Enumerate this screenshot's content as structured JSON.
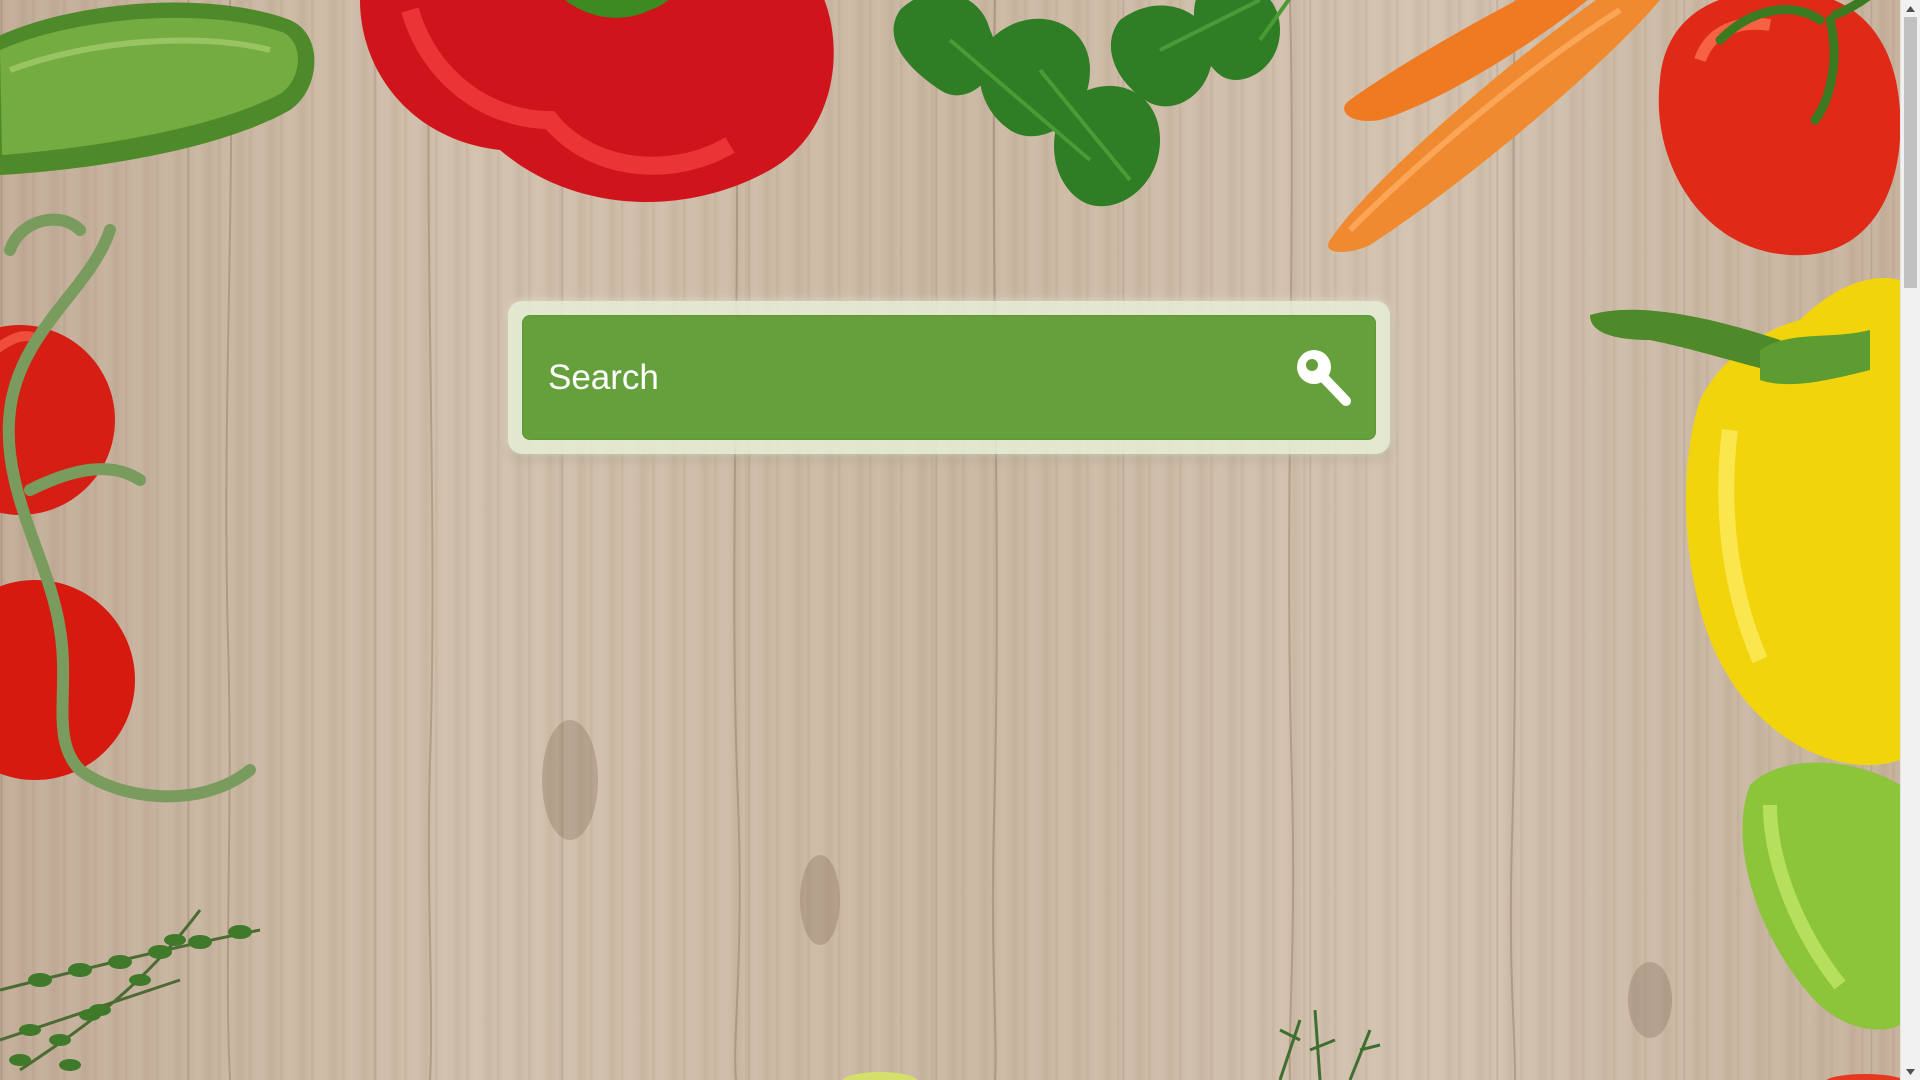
{
  "search": {
    "placeholder": "Search",
    "button_icon": "search-icon"
  },
  "colors": {
    "search_field": "#66a03c",
    "search_frame": "#e6eed7",
    "background_wood": "#cbb8a3"
  },
  "scrollbar": {
    "up_icon": "chevron-up-icon",
    "down_icon": "chevron-down-icon"
  },
  "decorations": [
    "cucumber",
    "red-bell-pepper",
    "parsley",
    "carrots",
    "tomato",
    "cherry-tomatoes-on-vine",
    "yellow-bell-pepper",
    "green-pepper",
    "thyme",
    "rosemary"
  ]
}
